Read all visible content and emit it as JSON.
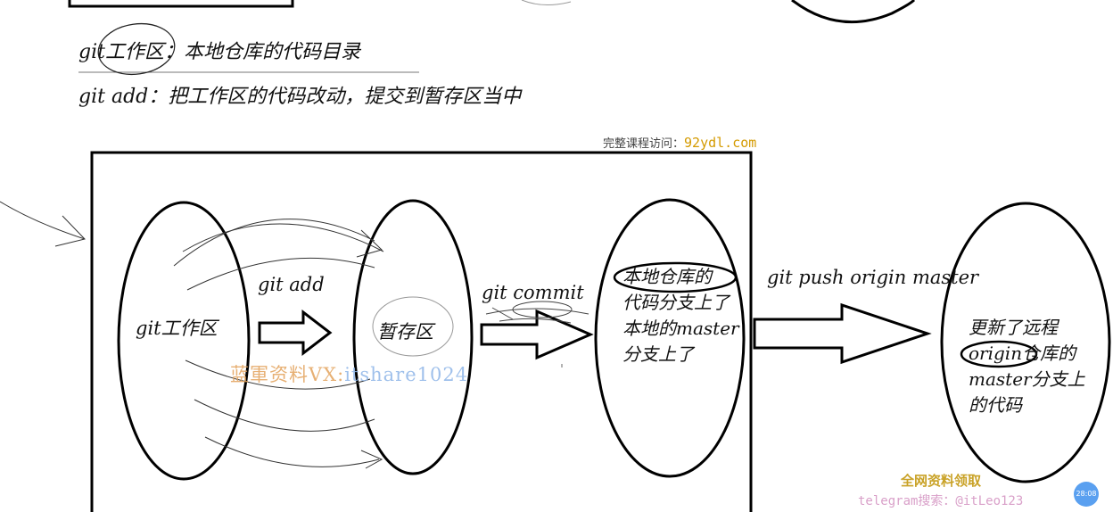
{
  "notes": {
    "line1": "git工作区：本地仓库的代码目录",
    "line2": "git add：把工作区的代码改动，提交到暂存区当中"
  },
  "diagram": {
    "workspace": "git工作区",
    "staging": "暂存区",
    "local_repo": [
      "本地仓库的",
      "代码分支上了",
      "本地的master",
      "分支上了"
    ],
    "remote_repo": [
      "更新了远程",
      "origin仓库的",
      "master分支上",
      "的代码"
    ],
    "cmd_add": "git add",
    "cmd_commit": "git commit",
    "cmd_push": "git push origin master"
  },
  "watermarks": {
    "top_prefix": "完整课程访问：",
    "top_site": "92ydl.com",
    "middle_cn": "蓝軍资料VX:",
    "middle_id": "itshare1024",
    "bottom_1": "全网资料领取",
    "bottom_2": "telegram搜索：@itLeo123",
    "badge": "28:08"
  }
}
